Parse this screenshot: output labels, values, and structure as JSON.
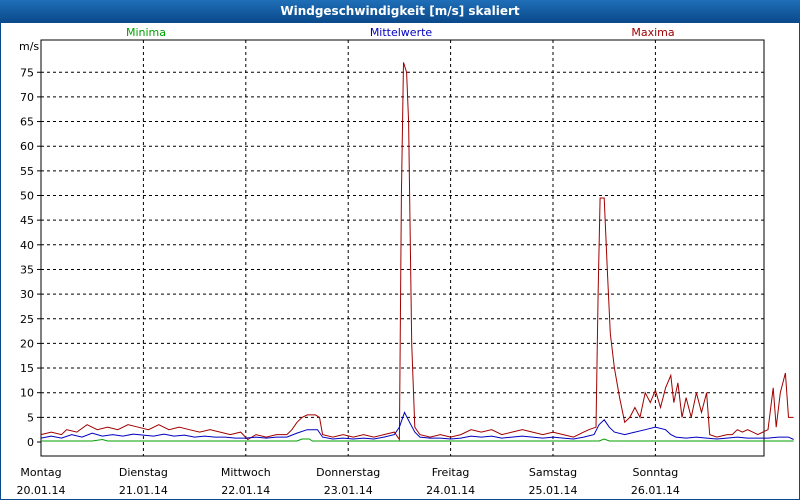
{
  "window": {
    "title": "Windgeschwindigkeit [m/s] skaliert"
  },
  "legend": [
    {
      "label": "Minima",
      "color": "#00a000"
    },
    {
      "label": "Mittelwerte",
      "color": "#0000c0"
    },
    {
      "label": "Maxima",
      "color": "#a00000"
    }
  ],
  "chart_data": {
    "type": "line",
    "ylabel": "m/s",
    "ylim": [
      -3,
      80
    ],
    "yticks": [
      0,
      5,
      10,
      15,
      20,
      25,
      30,
      35,
      40,
      45,
      50,
      55,
      60,
      65,
      70,
      75
    ],
    "xlim": [
      0,
      7
    ],
    "xticks": [
      {
        "x": 0,
        "day": "Montag",
        "date": "20.01.14"
      },
      {
        "x": 1,
        "day": "Dienstag",
        "date": "21.01.14"
      },
      {
        "x": 2,
        "day": "Mittwoch",
        "date": "22.01.14"
      },
      {
        "x": 3,
        "day": "Donnerstag",
        "date": "23.01.14"
      },
      {
        "x": 4,
        "day": "Freitag",
        "date": "24.01.14"
      },
      {
        "x": 5,
        "day": "Samstag",
        "date": "25.01.14"
      },
      {
        "x": 6,
        "day": "Sonntag",
        "date": "26.01.14"
      }
    ],
    "grid": true,
    "legend_position": "top",
    "series": [
      {
        "name": "Maxima",
        "color": "#a00000",
        "points": [
          [
            0.0,
            1.5
          ],
          [
            0.1,
            2.0
          ],
          [
            0.2,
            1.5
          ],
          [
            0.25,
            2.5
          ],
          [
            0.35,
            2.0
          ],
          [
            0.45,
            3.5
          ],
          [
            0.55,
            2.5
          ],
          [
            0.65,
            3.0
          ],
          [
            0.75,
            2.5
          ],
          [
            0.85,
            3.5
          ],
          [
            0.95,
            3.0
          ],
          [
            1.05,
            2.5
          ],
          [
            1.15,
            3.5
          ],
          [
            1.25,
            2.5
          ],
          [
            1.35,
            3.0
          ],
          [
            1.45,
            2.5
          ],
          [
            1.55,
            2.0
          ],
          [
            1.65,
            2.5
          ],
          [
            1.75,
            2.0
          ],
          [
            1.85,
            1.5
          ],
          [
            1.95,
            2.0
          ],
          [
            2.02,
            0.5
          ],
          [
            2.1,
            1.5
          ],
          [
            2.2,
            1.0
          ],
          [
            2.3,
            1.5
          ],
          [
            2.4,
            1.5
          ],
          [
            2.45,
            2.5
          ],
          [
            2.5,
            4.0
          ],
          [
            2.55,
            5.0
          ],
          [
            2.6,
            5.5
          ],
          [
            2.68,
            5.5
          ],
          [
            2.72,
            5.0
          ],
          [
            2.75,
            1.5
          ],
          [
            2.85,
            1.0
          ],
          [
            2.95,
            1.5
          ],
          [
            3.05,
            1.0
          ],
          [
            3.15,
            1.5
          ],
          [
            3.25,
            1.0
          ],
          [
            3.35,
            1.5
          ],
          [
            3.45,
            2.0
          ],
          [
            3.5,
            0.5
          ],
          [
            3.52,
            50.0
          ],
          [
            3.54,
            77.0
          ],
          [
            3.57,
            75.0
          ],
          [
            3.59,
            65.0
          ],
          [
            3.62,
            20.0
          ],
          [
            3.65,
            3.0
          ],
          [
            3.7,
            1.5
          ],
          [
            3.8,
            1.0
          ],
          [
            3.9,
            1.5
          ],
          [
            4.0,
            1.0
          ],
          [
            4.1,
            1.5
          ],
          [
            4.2,
            2.5
          ],
          [
            4.3,
            2.0
          ],
          [
            4.4,
            2.5
          ],
          [
            4.5,
            1.5
          ],
          [
            4.6,
            2.0
          ],
          [
            4.7,
            2.5
          ],
          [
            4.8,
            2.0
          ],
          [
            4.9,
            1.5
          ],
          [
            5.0,
            2.0
          ],
          [
            5.1,
            1.5
          ],
          [
            5.2,
            1.0
          ],
          [
            5.3,
            2.0
          ],
          [
            5.35,
            2.5
          ],
          [
            5.42,
            3.0
          ],
          [
            5.44,
            30.0
          ],
          [
            5.46,
            49.5
          ],
          [
            5.5,
            49.5
          ],
          [
            5.53,
            35.0
          ],
          [
            5.56,
            22.0
          ],
          [
            5.6,
            15.0
          ],
          [
            5.65,
            9.0
          ],
          [
            5.7,
            4.0
          ],
          [
            5.75,
            5.0
          ],
          [
            5.8,
            7.0
          ],
          [
            5.85,
            5.0
          ],
          [
            5.9,
            10.0
          ],
          [
            5.95,
            8.0
          ],
          [
            6.0,
            10.5
          ],
          [
            6.05,
            7.0
          ],
          [
            6.1,
            11.0
          ],
          [
            6.15,
            13.5
          ],
          [
            6.18,
            8.0
          ],
          [
            6.22,
            12.0
          ],
          [
            6.26,
            5.0
          ],
          [
            6.3,
            9.0
          ],
          [
            6.35,
            5.0
          ],
          [
            6.4,
            10.0
          ],
          [
            6.45,
            6.0
          ],
          [
            6.5,
            10.0
          ],
          [
            6.53,
            1.5
          ],
          [
            6.6,
            1.0
          ],
          [
            6.7,
            1.5
          ],
          [
            6.75,
            1.5
          ],
          [
            6.8,
            2.5
          ],
          [
            6.85,
            2.0
          ],
          [
            6.9,
            2.5
          ],
          [
            6.95,
            2.0
          ],
          [
            7.0,
            1.5
          ],
          [
            7.05,
            2.0
          ],
          [
            7.1,
            2.5
          ],
          [
            7.15,
            11.0
          ],
          [
            7.18,
            3.0
          ],
          [
            7.22,
            10.0
          ],
          [
            7.27,
            14.0
          ],
          [
            7.3,
            5.0
          ],
          [
            7.35,
            5.0
          ]
        ]
      },
      {
        "name": "Mittelwerte",
        "color": "#0000c0",
        "points": [
          [
            0.0,
            0.8
          ],
          [
            0.1,
            1.2
          ],
          [
            0.2,
            0.8
          ],
          [
            0.3,
            1.5
          ],
          [
            0.4,
            1.0
          ],
          [
            0.5,
            1.8
          ],
          [
            0.6,
            1.2
          ],
          [
            0.7,
            1.5
          ],
          [
            0.8,
            1.2
          ],
          [
            0.9,
            1.6
          ],
          [
            1.0,
            1.4
          ],
          [
            1.1,
            1.2
          ],
          [
            1.2,
            1.6
          ],
          [
            1.3,
            1.2
          ],
          [
            1.4,
            1.4
          ],
          [
            1.5,
            1.0
          ],
          [
            1.6,
            1.2
          ],
          [
            1.7,
            1.0
          ],
          [
            1.8,
            1.0
          ],
          [
            1.9,
            0.8
          ],
          [
            2.0,
            0.8
          ],
          [
            2.1,
            1.0
          ],
          [
            2.2,
            0.8
          ],
          [
            2.3,
            1.0
          ],
          [
            2.4,
            1.0
          ],
          [
            2.5,
            1.8
          ],
          [
            2.6,
            2.5
          ],
          [
            2.7,
            2.5
          ],
          [
            2.75,
            1.0
          ],
          [
            2.85,
            0.6
          ],
          [
            2.95,
            0.8
          ],
          [
            3.05,
            0.6
          ],
          [
            3.15,
            0.8
          ],
          [
            3.25,
            0.6
          ],
          [
            3.35,
            1.0
          ],
          [
            3.45,
            1.5
          ],
          [
            3.5,
            3.0
          ],
          [
            3.55,
            6.0
          ],
          [
            3.6,
            4.0
          ],
          [
            3.65,
            2.0
          ],
          [
            3.7,
            1.0
          ],
          [
            3.8,
            0.8
          ],
          [
            3.9,
            0.8
          ],
          [
            4.0,
            0.6
          ],
          [
            4.1,
            0.8
          ],
          [
            4.2,
            1.2
          ],
          [
            4.3,
            1.0
          ],
          [
            4.4,
            1.2
          ],
          [
            4.5,
            0.8
          ],
          [
            4.6,
            1.0
          ],
          [
            4.7,
            1.2
          ],
          [
            4.8,
            1.0
          ],
          [
            4.9,
            0.8
          ],
          [
            5.0,
            1.0
          ],
          [
            5.1,
            0.8
          ],
          [
            5.2,
            0.6
          ],
          [
            5.3,
            1.0
          ],
          [
            5.4,
            1.5
          ],
          [
            5.45,
            3.5
          ],
          [
            5.5,
            4.5
          ],
          [
            5.55,
            3.0
          ],
          [
            5.6,
            2.0
          ],
          [
            5.7,
            1.5
          ],
          [
            5.8,
            2.0
          ],
          [
            5.9,
            2.5
          ],
          [
            6.0,
            3.0
          ],
          [
            6.1,
            2.5
          ],
          [
            6.15,
            1.5
          ],
          [
            6.2,
            1.0
          ],
          [
            6.3,
            0.8
          ],
          [
            6.4,
            1.0
          ],
          [
            6.5,
            0.8
          ],
          [
            6.6,
            0.6
          ],
          [
            6.7,
            0.8
          ],
          [
            6.8,
            1.0
          ],
          [
            6.9,
            0.8
          ],
          [
            7.0,
            0.8
          ],
          [
            7.1,
            0.8
          ],
          [
            7.2,
            1.0
          ],
          [
            7.3,
            1.0
          ],
          [
            7.35,
            0.5
          ]
        ]
      },
      {
        "name": "Minima",
        "color": "#00a000",
        "points": [
          [
            0.0,
            0.2
          ],
          [
            0.5,
            0.2
          ],
          [
            0.6,
            0.5
          ],
          [
            0.65,
            0.2
          ],
          [
            1.0,
            0.2
          ],
          [
            1.5,
            0.2
          ],
          [
            2.0,
            0.2
          ],
          [
            2.5,
            0.2
          ],
          [
            2.55,
            0.6
          ],
          [
            2.62,
            0.6
          ],
          [
            2.65,
            0.2
          ],
          [
            3.0,
            0.2
          ],
          [
            3.5,
            0.2
          ],
          [
            4.0,
            0.2
          ],
          [
            4.5,
            0.2
          ],
          [
            5.0,
            0.2
          ],
          [
            5.45,
            0.2
          ],
          [
            5.5,
            0.6
          ],
          [
            5.55,
            0.2
          ],
          [
            6.0,
            0.2
          ],
          [
            6.5,
            0.2
          ],
          [
            7.0,
            0.2
          ],
          [
            7.35,
            0.2
          ]
        ]
      }
    ]
  }
}
